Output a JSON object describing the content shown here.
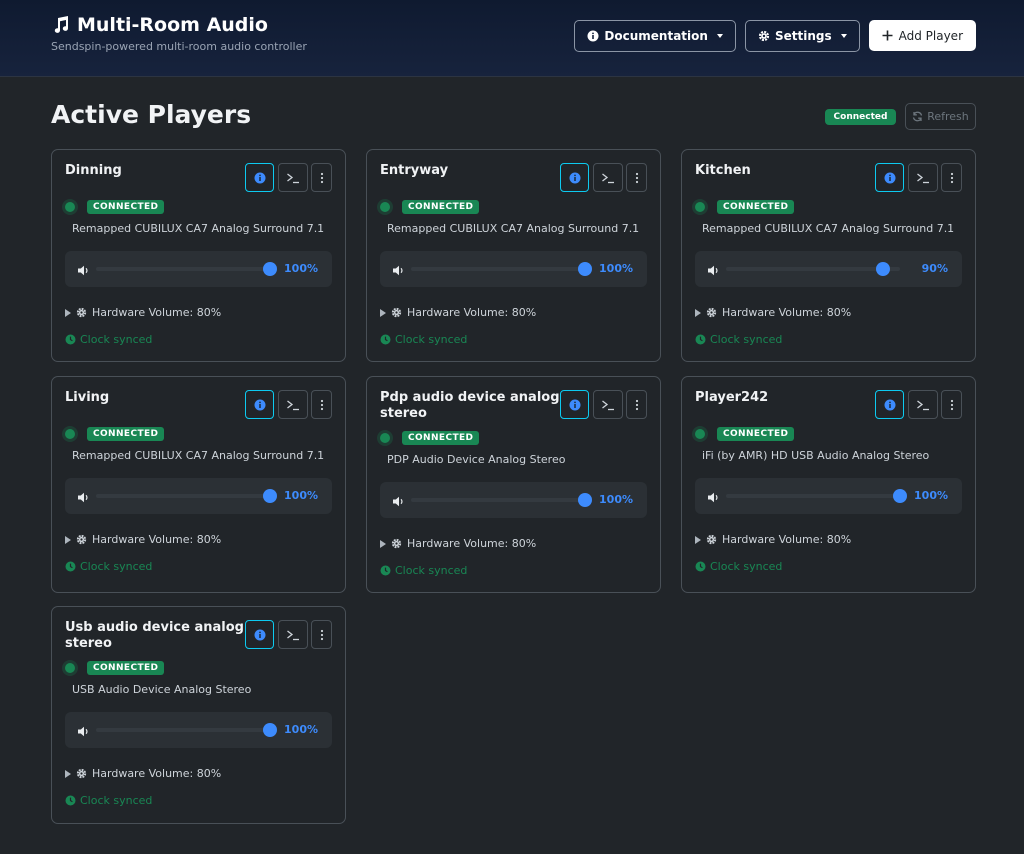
{
  "header": {
    "title": "Multi-Room Audio",
    "subtitle": "Sendspin-powered multi-room audio controller",
    "documentation_label": "Documentation",
    "settings_label": "Settings",
    "add_player_label": "Add Player"
  },
  "main": {
    "title": "Active Players",
    "status": "Connected",
    "refresh_label": "Refresh"
  },
  "colors": {
    "accent": "#3d8bfd",
    "success": "#198754",
    "info": "#0dcaf0"
  },
  "players": [
    {
      "name": "Dinning",
      "status": "CONNECTED",
      "device": "Remapped CUBILUX CA7 Analog Surround 7.1",
      "volume": 100,
      "volume_label": "100%",
      "hardware_volume": "Hardware Volume: 80%",
      "clock": "Clock synced"
    },
    {
      "name": "Entryway",
      "status": "CONNECTED",
      "device": "Remapped CUBILUX CA7 Analog Surround 7.1",
      "volume": 100,
      "volume_label": "100%",
      "hardware_volume": "Hardware Volume: 80%",
      "clock": "Clock synced"
    },
    {
      "name": "Kitchen",
      "status": "CONNECTED",
      "device": "Remapped CUBILUX CA7 Analog Surround 7.1",
      "volume": 90,
      "volume_label": "90%",
      "hardware_volume": "Hardware Volume: 80%",
      "clock": "Clock synced"
    },
    {
      "name": "Living",
      "status": "CONNECTED",
      "device": "Remapped CUBILUX CA7 Analog Surround 7.1",
      "volume": 100,
      "volume_label": "100%",
      "hardware_volume": "Hardware Volume: 80%",
      "clock": "Clock synced"
    },
    {
      "name": "Pdp audio device analog stereo",
      "status": "CONNECTED",
      "device": "PDP Audio Device Analog Stereo",
      "volume": 100,
      "volume_label": "100%",
      "hardware_volume": "Hardware Volume: 80%",
      "clock": "Clock synced"
    },
    {
      "name": "Player242",
      "status": "CONNECTED",
      "device": "iFi (by AMR) HD USB Audio Analog Stereo",
      "volume": 100,
      "volume_label": "100%",
      "hardware_volume": "Hardware Volume: 80%",
      "clock": "Clock synced"
    },
    {
      "name": "Usb audio device analog stereo",
      "status": "CONNECTED",
      "device": "USB Audio Device Analog Stereo",
      "volume": 100,
      "volume_label": "100%",
      "hardware_volume": "Hardware Volume: 80%",
      "clock": "Clock synced"
    }
  ]
}
